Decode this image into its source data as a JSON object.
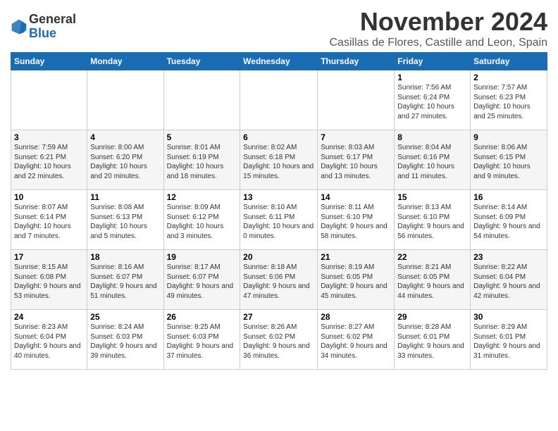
{
  "logo": {
    "general": "General",
    "blue": "Blue"
  },
  "title": "November 2024",
  "subtitle": "Casillas de Flores, Castille and Leon, Spain",
  "days_of_week": [
    "Sunday",
    "Monday",
    "Tuesday",
    "Wednesday",
    "Thursday",
    "Friday",
    "Saturday"
  ],
  "weeks": [
    [
      {
        "day": "",
        "info": ""
      },
      {
        "day": "",
        "info": ""
      },
      {
        "day": "",
        "info": ""
      },
      {
        "day": "",
        "info": ""
      },
      {
        "day": "",
        "info": ""
      },
      {
        "day": "1",
        "info": "Sunrise: 7:56 AM\nSunset: 6:24 PM\nDaylight: 10 hours and 27 minutes."
      },
      {
        "day": "2",
        "info": "Sunrise: 7:57 AM\nSunset: 6:23 PM\nDaylight: 10 hours and 25 minutes."
      }
    ],
    [
      {
        "day": "3",
        "info": "Sunrise: 7:59 AM\nSunset: 6:21 PM\nDaylight: 10 hours and 22 minutes."
      },
      {
        "day": "4",
        "info": "Sunrise: 8:00 AM\nSunset: 6:20 PM\nDaylight: 10 hours and 20 minutes."
      },
      {
        "day": "5",
        "info": "Sunrise: 8:01 AM\nSunset: 6:19 PM\nDaylight: 10 hours and 18 minutes."
      },
      {
        "day": "6",
        "info": "Sunrise: 8:02 AM\nSunset: 6:18 PM\nDaylight: 10 hours and 15 minutes."
      },
      {
        "day": "7",
        "info": "Sunrise: 8:03 AM\nSunset: 6:17 PM\nDaylight: 10 hours and 13 minutes."
      },
      {
        "day": "8",
        "info": "Sunrise: 8:04 AM\nSunset: 6:16 PM\nDaylight: 10 hours and 11 minutes."
      },
      {
        "day": "9",
        "info": "Sunrise: 8:06 AM\nSunset: 6:15 PM\nDaylight: 10 hours and 9 minutes."
      }
    ],
    [
      {
        "day": "10",
        "info": "Sunrise: 8:07 AM\nSunset: 6:14 PM\nDaylight: 10 hours and 7 minutes."
      },
      {
        "day": "11",
        "info": "Sunrise: 8:08 AM\nSunset: 6:13 PM\nDaylight: 10 hours and 5 minutes."
      },
      {
        "day": "12",
        "info": "Sunrise: 8:09 AM\nSunset: 6:12 PM\nDaylight: 10 hours and 3 minutes."
      },
      {
        "day": "13",
        "info": "Sunrise: 8:10 AM\nSunset: 6:11 PM\nDaylight: 10 hours and 0 minutes."
      },
      {
        "day": "14",
        "info": "Sunrise: 8:11 AM\nSunset: 6:10 PM\nDaylight: 9 hours and 58 minutes."
      },
      {
        "day": "15",
        "info": "Sunrise: 8:13 AM\nSunset: 6:10 PM\nDaylight: 9 hours and 56 minutes."
      },
      {
        "day": "16",
        "info": "Sunrise: 8:14 AM\nSunset: 6:09 PM\nDaylight: 9 hours and 54 minutes."
      }
    ],
    [
      {
        "day": "17",
        "info": "Sunrise: 8:15 AM\nSunset: 6:08 PM\nDaylight: 9 hours and 53 minutes."
      },
      {
        "day": "18",
        "info": "Sunrise: 8:16 AM\nSunset: 6:07 PM\nDaylight: 9 hours and 51 minutes."
      },
      {
        "day": "19",
        "info": "Sunrise: 8:17 AM\nSunset: 6:07 PM\nDaylight: 9 hours and 49 minutes."
      },
      {
        "day": "20",
        "info": "Sunrise: 8:18 AM\nSunset: 6:06 PM\nDaylight: 9 hours and 47 minutes."
      },
      {
        "day": "21",
        "info": "Sunrise: 8:19 AM\nSunset: 6:05 PM\nDaylight: 9 hours and 45 minutes."
      },
      {
        "day": "22",
        "info": "Sunrise: 8:21 AM\nSunset: 6:05 PM\nDaylight: 9 hours and 44 minutes."
      },
      {
        "day": "23",
        "info": "Sunrise: 8:22 AM\nSunset: 6:04 PM\nDaylight: 9 hours and 42 minutes."
      }
    ],
    [
      {
        "day": "24",
        "info": "Sunrise: 8:23 AM\nSunset: 6:04 PM\nDaylight: 9 hours and 40 minutes."
      },
      {
        "day": "25",
        "info": "Sunrise: 8:24 AM\nSunset: 6:03 PM\nDaylight: 9 hours and 39 minutes."
      },
      {
        "day": "26",
        "info": "Sunrise: 8:25 AM\nSunset: 6:03 PM\nDaylight: 9 hours and 37 minutes."
      },
      {
        "day": "27",
        "info": "Sunrise: 8:26 AM\nSunset: 6:02 PM\nDaylight: 9 hours and 36 minutes."
      },
      {
        "day": "28",
        "info": "Sunrise: 8:27 AM\nSunset: 6:02 PM\nDaylight: 9 hours and 34 minutes."
      },
      {
        "day": "29",
        "info": "Sunrise: 8:28 AM\nSunset: 6:01 PM\nDaylight: 9 hours and 33 minutes."
      },
      {
        "day": "30",
        "info": "Sunrise: 8:29 AM\nSunset: 6:01 PM\nDaylight: 9 hours and 31 minutes."
      }
    ]
  ]
}
